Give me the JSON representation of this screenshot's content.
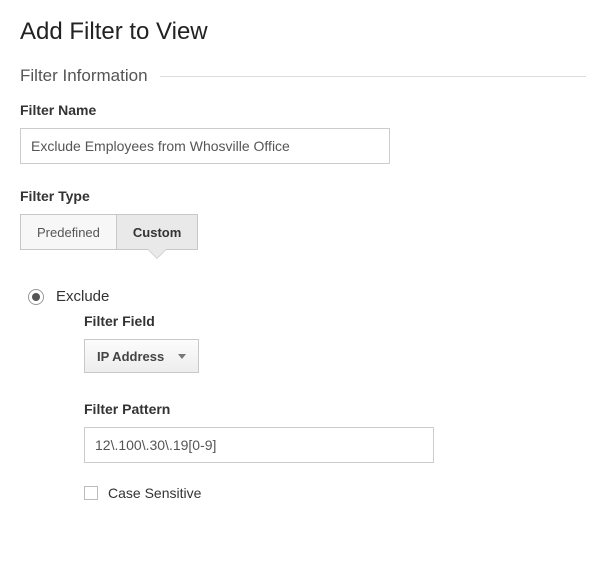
{
  "page_title": "Add Filter to View",
  "section": {
    "title": "Filter Information"
  },
  "filter_name": {
    "label": "Filter Name",
    "value": "Exclude Employees from Whosville Office"
  },
  "filter_type": {
    "label": "Filter Type",
    "tabs": {
      "predefined": "Predefined",
      "custom": "Custom"
    }
  },
  "exclude": {
    "label": "Exclude"
  },
  "filter_field": {
    "label": "Filter Field",
    "selected": "IP Address"
  },
  "filter_pattern": {
    "label": "Filter Pattern",
    "value": "12\\.100\\.30\\.19[0-9]"
  },
  "case_sensitive": {
    "label": "Case Sensitive"
  }
}
